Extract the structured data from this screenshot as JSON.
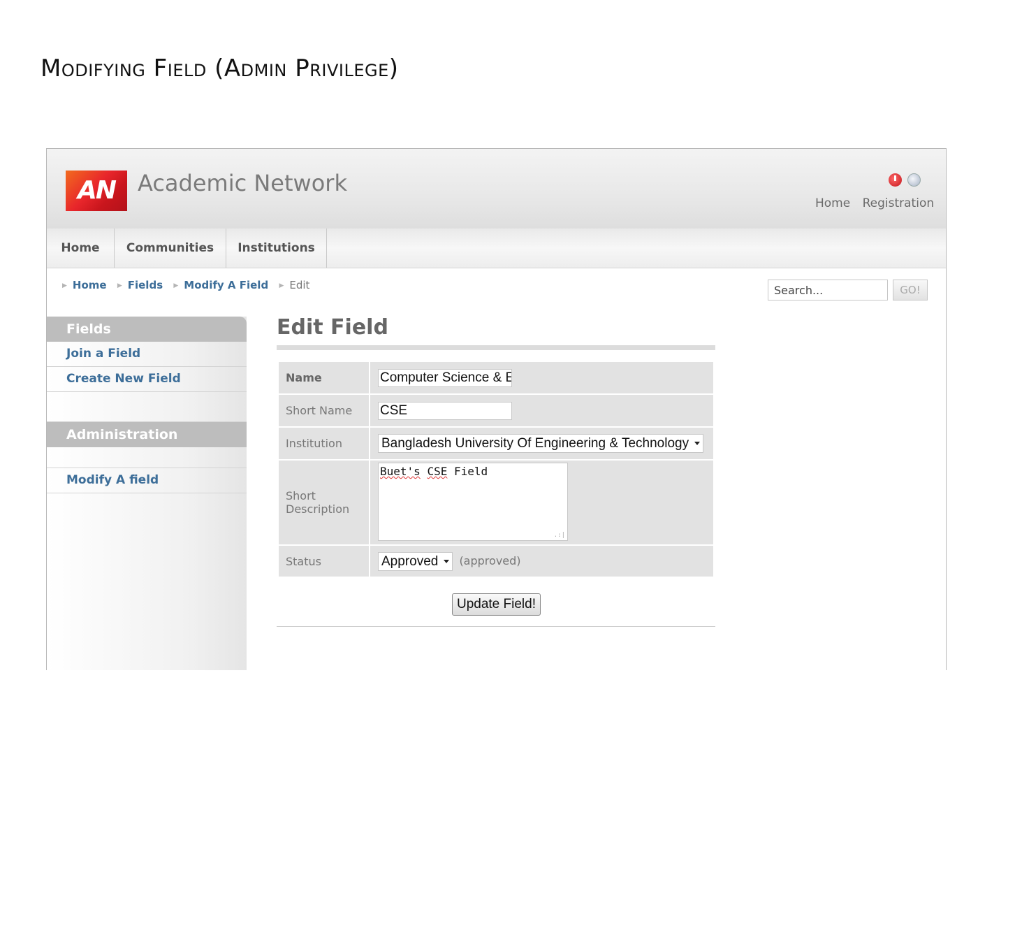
{
  "document": {
    "title": "Modifying Field (Admin Privilege)"
  },
  "header": {
    "logo_text": "AN",
    "site_name": "Academic Network",
    "top_links": [
      "Home",
      "Registration"
    ]
  },
  "nav": {
    "tabs": [
      "Home",
      "Communities",
      "Institutions"
    ]
  },
  "breadcrumb": {
    "items": [
      "Home",
      "Fields",
      "Modify A Field"
    ],
    "current": "Edit"
  },
  "search": {
    "value": "Search...",
    "button_label": "GO!"
  },
  "sidebar": {
    "fields_heading": "Fields",
    "fields_items": [
      "Join a Field",
      "Create New Field"
    ],
    "admin_heading": "Administration",
    "admin_items": [
      "Modify A field"
    ]
  },
  "form": {
    "title": "Edit Field",
    "name_label": "Name",
    "name_value": "Computer Science & E",
    "short_name_label": "Short Name",
    "short_name_value": "CSE",
    "institution_label": "Institution",
    "institution_value": "Bangladesh University Of Engineering & Technology",
    "description_label_line1": "Short",
    "description_label_line2": "Description",
    "description_word1": "Buet's",
    "description_word2": "CSE",
    "description_word3": "Field",
    "status_label": "Status",
    "status_value": "Approved",
    "status_note": "(approved)",
    "submit_label": "Update Field!"
  },
  "icons": [
    "power-icon",
    "user-icon",
    "breadcrumb-arrow-icon",
    "dropdown-caret-icon",
    "resize-grip-icon"
  ],
  "colors": {
    "link": "#3d6e99",
    "logo_red": "#e8262b",
    "sidebar_heading": "#bdbdbd"
  }
}
